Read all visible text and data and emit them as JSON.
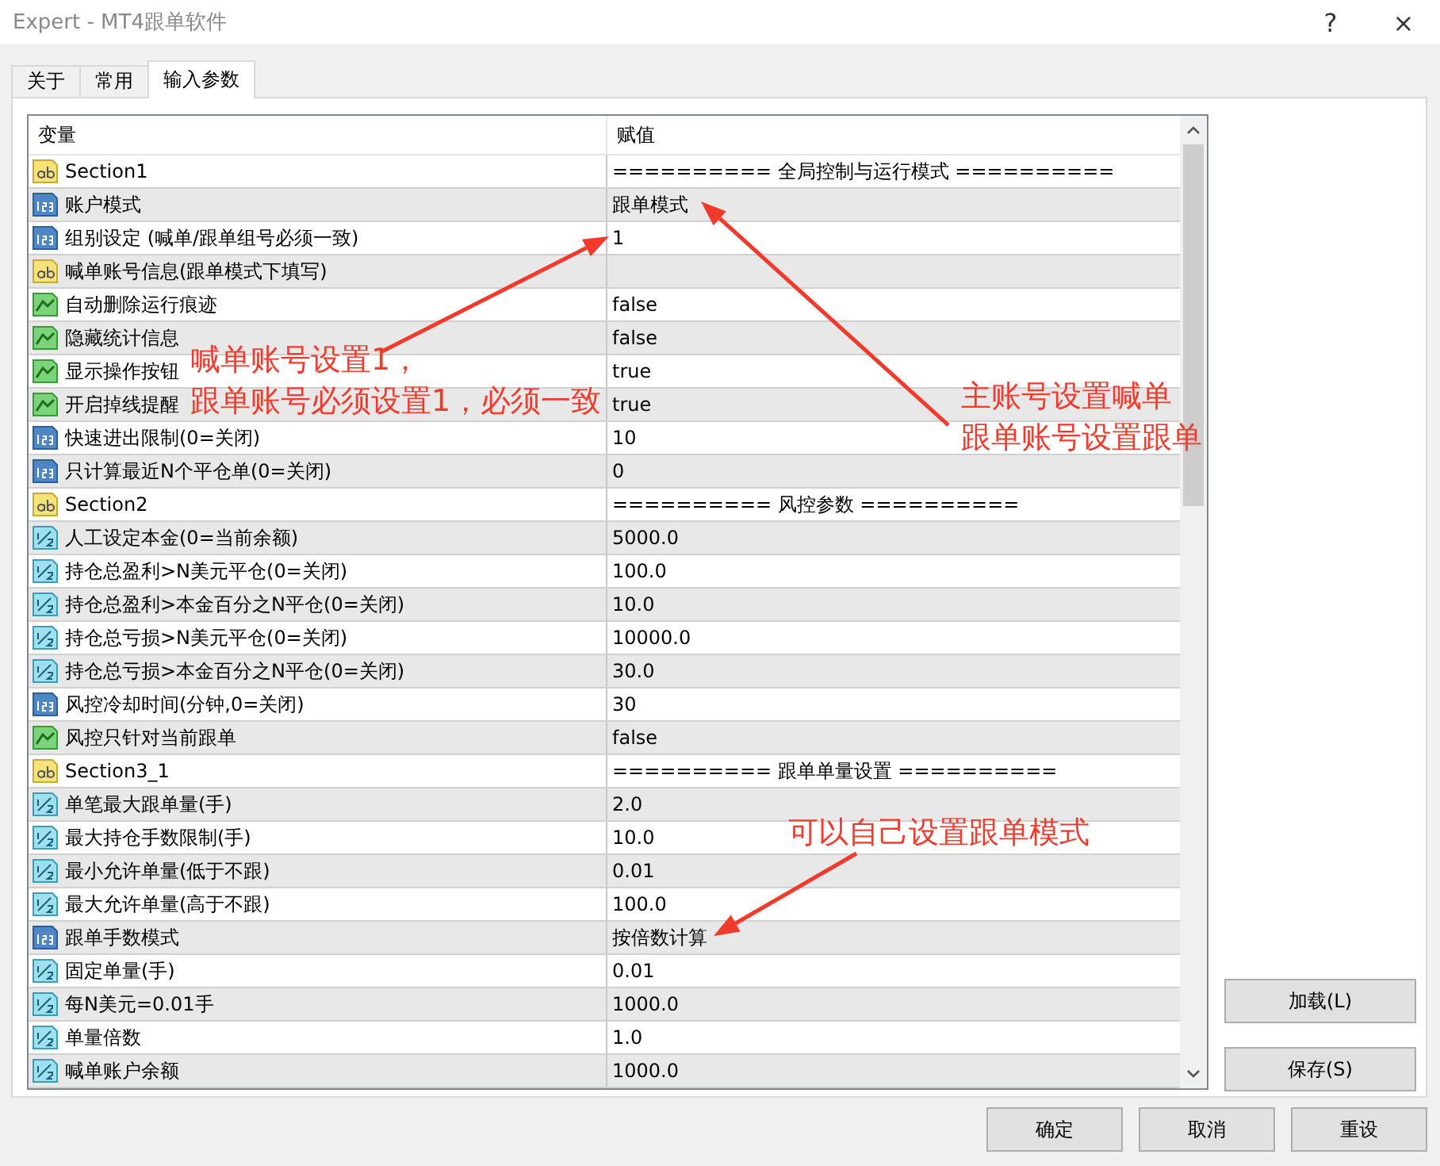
{
  "window": {
    "title": "Expert - MT4跟单软件",
    "help": "?",
    "close": "×"
  },
  "tabs": [
    {
      "label": "关于",
      "selected": false
    },
    {
      "label": "常用",
      "selected": false
    },
    {
      "label": "输入参数",
      "selected": true
    }
  ],
  "table": {
    "columns": [
      "变量",
      "赋值"
    ],
    "rows": [
      {
        "kind": "string",
        "name": "Section1",
        "value": "========== 全局控制与运行模式 =========="
      },
      {
        "kind": "int",
        "name": "账户模式",
        "value": "跟单模式"
      },
      {
        "kind": "int",
        "name": "组别设定 (喊单/跟单组号必须一致)",
        "value": "1"
      },
      {
        "kind": "string",
        "name": "喊单账号信息(跟单模式下填写)"
      },
      {
        "kind": "bool",
        "name": "自动删除运行痕迹",
        "value": "false"
      },
      {
        "kind": "bool",
        "name": "隐藏统计信息",
        "value": "false"
      },
      {
        "kind": "bool",
        "name": "显示操作按钮",
        "value": "true"
      },
      {
        "kind": "bool",
        "name": "开启掉线提醒",
        "value": "true"
      },
      {
        "kind": "int",
        "name": "快速进出限制(0=关闭)",
        "value": "10"
      },
      {
        "kind": "int",
        "name": "只计算最近N个平仓单(0=关闭)",
        "value": "0"
      },
      {
        "kind": "string",
        "name": "Section2",
        "value": "========== 风控参数 =========="
      },
      {
        "kind": "double",
        "name": "人工设定本金(0=当前余额)",
        "value": "5000.0"
      },
      {
        "kind": "double",
        "name": "持仓总盈利>N美元平仓(0=关闭)",
        "value": "100.0"
      },
      {
        "kind": "double",
        "name": "持仓总盈利>本金百分之N平仓(0=关闭)",
        "value": "10.0"
      },
      {
        "kind": "double",
        "name": "持仓总亏损>N美元平仓(0=关闭)",
        "value": "10000.0"
      },
      {
        "kind": "double",
        "name": "持仓总亏损>本金百分之N平仓(0=关闭)",
        "value": "30.0"
      },
      {
        "kind": "int",
        "name": "风控冷却时间(分钟,0=关闭)",
        "value": "30"
      },
      {
        "kind": "bool",
        "name": "风控只针对当前跟单",
        "value": "false"
      },
      {
        "kind": "string",
        "name": "Section3_1",
        "value": "========== 跟单单量设置 =========="
      },
      {
        "kind": "double",
        "name": "单笔最大跟单量(手)",
        "value": "2.0"
      },
      {
        "kind": "double",
        "name": "最大持仓手数限制(手)",
        "value": "10.0"
      },
      {
        "kind": "double",
        "name": "最小允许单量(低于不跟)",
        "value": "0.01"
      },
      {
        "kind": "double",
        "name": "最大允许单量(高于不跟)",
        "value": "100.0"
      },
      {
        "kind": "int",
        "name": "跟单手数模式",
        "value": "按倍数计算"
      },
      {
        "kind": "double",
        "name": "固定单量(手)",
        "value": "0.01"
      },
      {
        "kind": "double",
        "name": "每N美元=0.01手",
        "value": "1000.0"
      },
      {
        "kind": "double",
        "name": "单量倍数",
        "value": "1.0"
      },
      {
        "kind": "double",
        "name": "喊单账户余额",
        "value": "1000.0"
      }
    ]
  },
  "side_buttons": [
    "加载(L)",
    "保存(S)"
  ],
  "buttons": [
    "确定",
    "取消",
    "重设"
  ],
  "annotations": [
    {
      "lines": [
        "喊单账号设置1，",
        "跟单账号必须设置1，必须一致"
      ]
    },
    {
      "lines": [
        "主账号设置喊单",
        "跟单账号设置跟单"
      ]
    },
    {
      "lines": [
        "可以自己设置跟单模式"
      ]
    }
  ]
}
